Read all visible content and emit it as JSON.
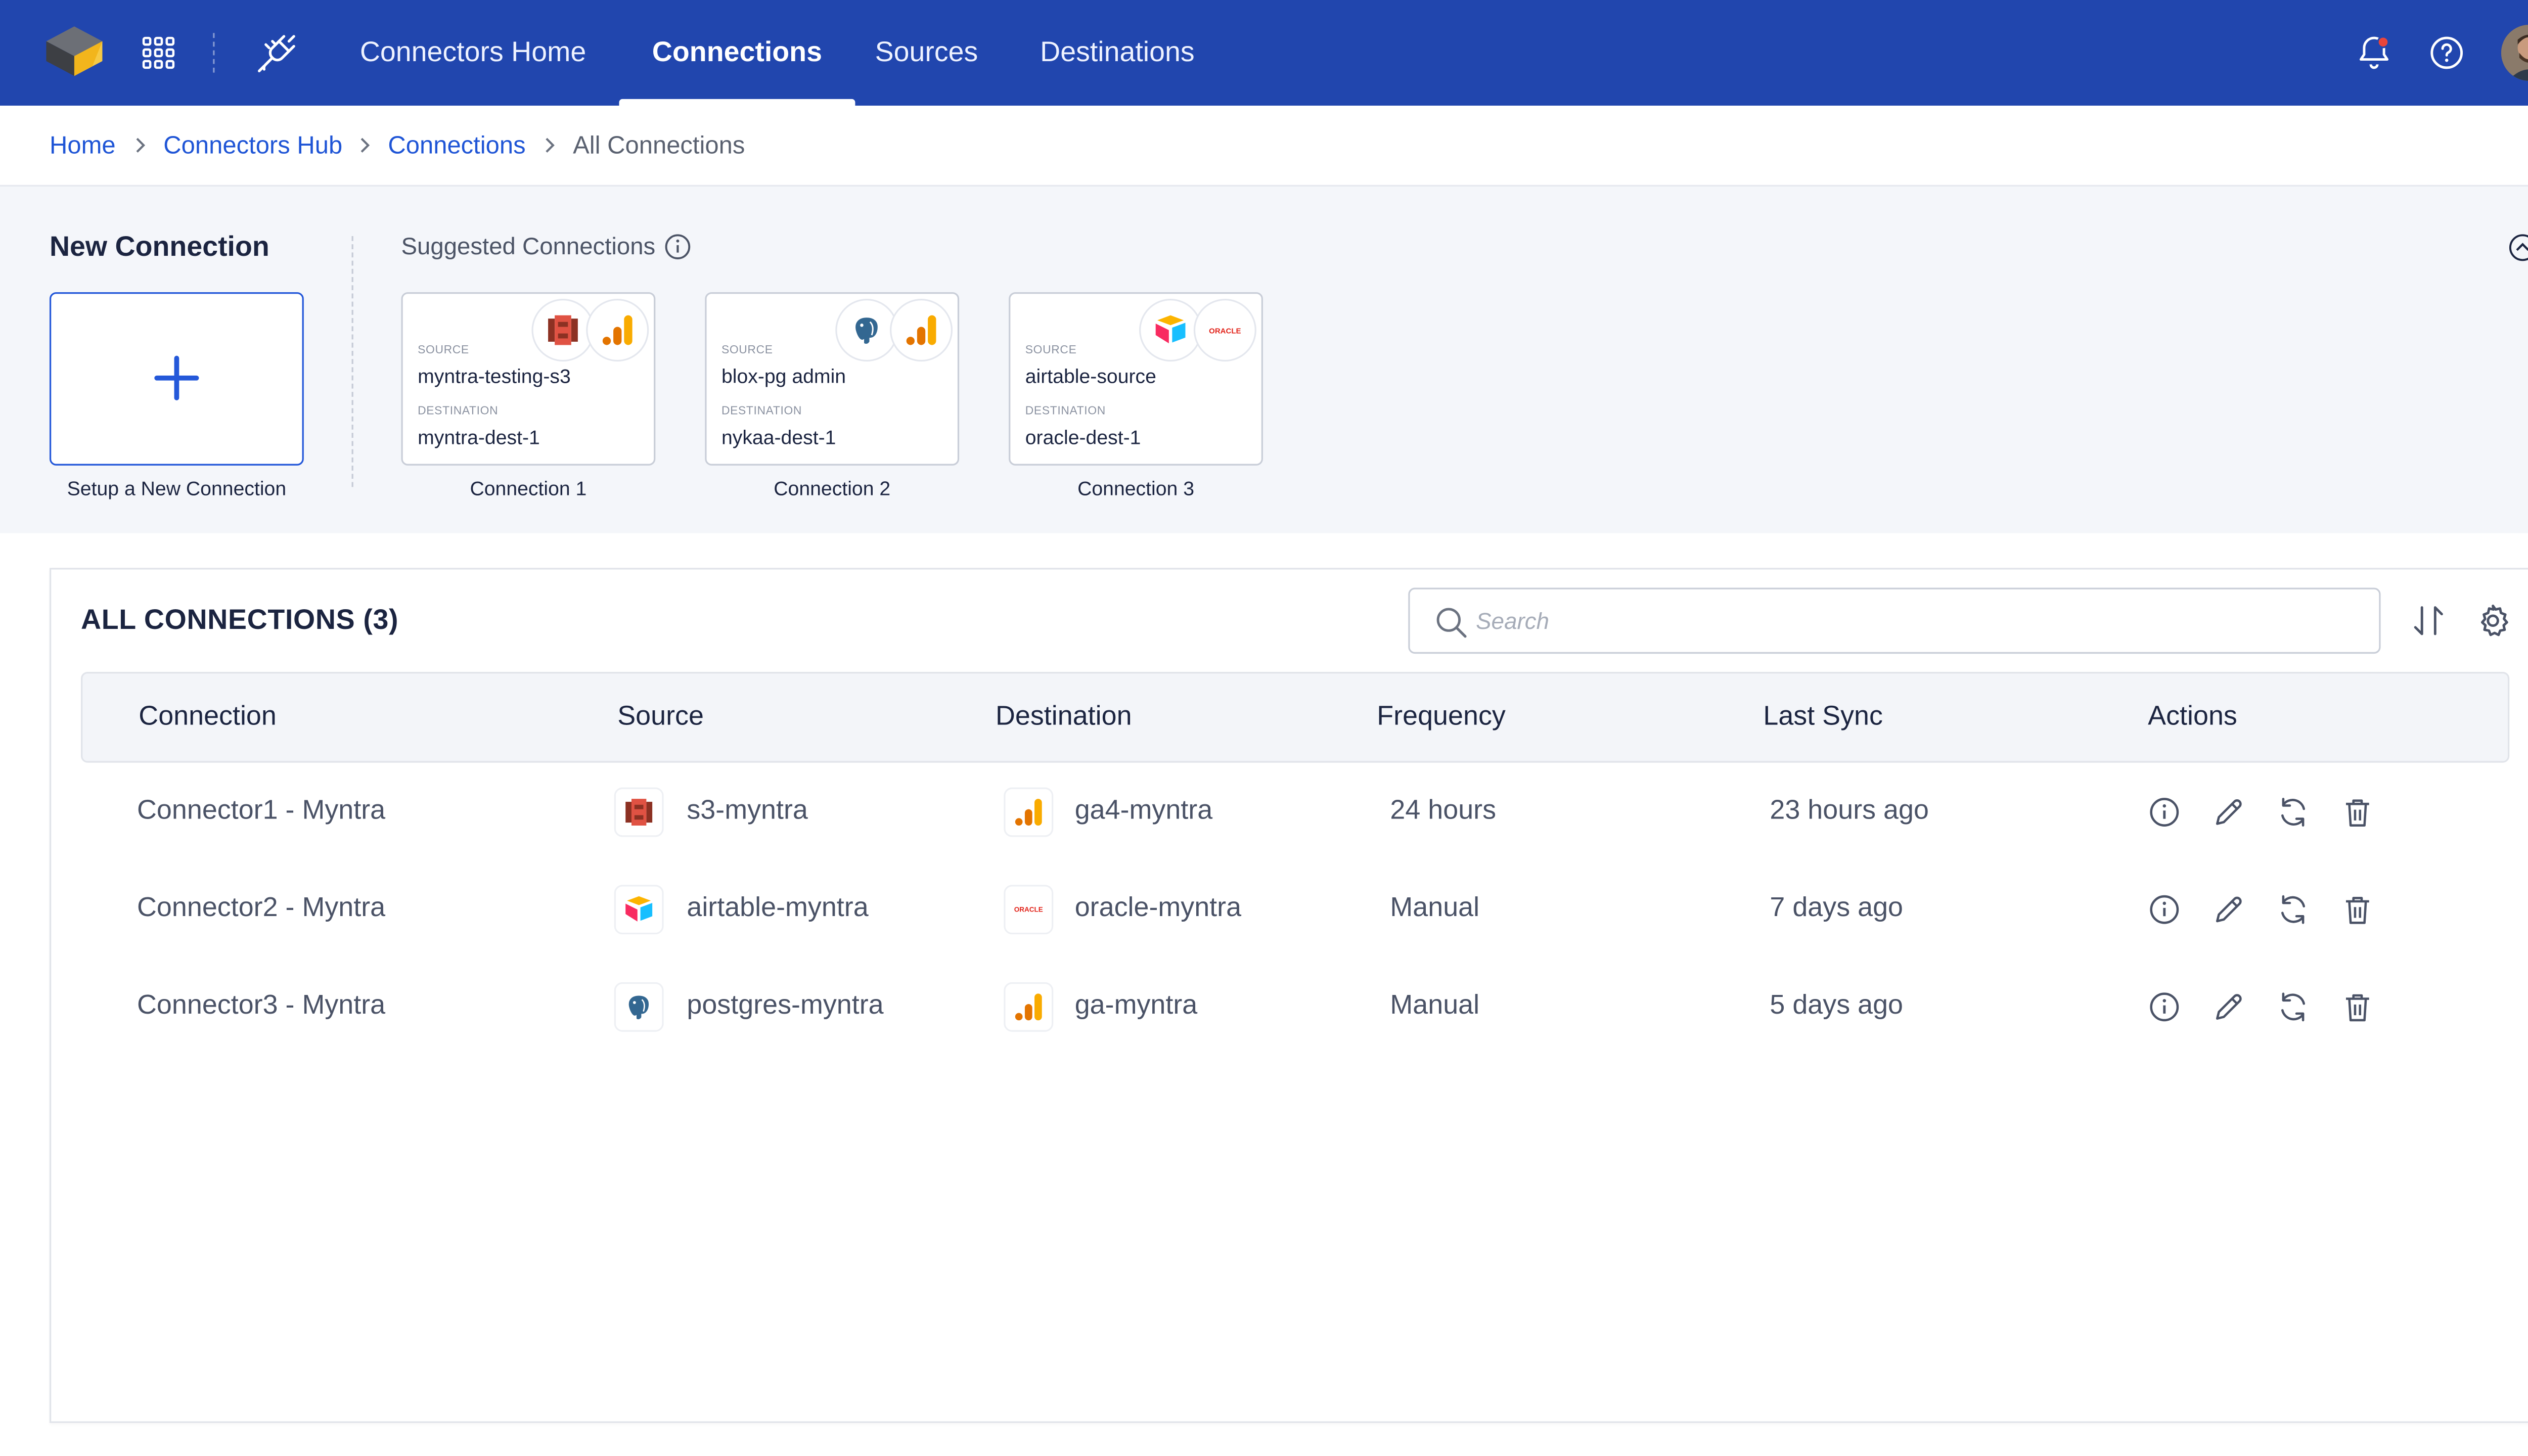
{
  "nav": {
    "tabs": [
      {
        "label": "Connectors Home",
        "active": false
      },
      {
        "label": "Connections",
        "active": true
      },
      {
        "label": "Sources",
        "active": false
      },
      {
        "label": "Destinations",
        "active": false
      }
    ],
    "brand_color": "#2146ae",
    "icons": [
      "logo-icon",
      "apps-grid-icon",
      "plug-icon",
      "bell-icon",
      "help-icon",
      "avatar"
    ]
  },
  "breadcrumb": [
    "Home",
    "Connectors Hub",
    "Connections",
    "All Connections"
  ],
  "new_connection": {
    "title": "New Connection",
    "add_label": "Setup a New Connection"
  },
  "suggested": {
    "title": "Suggested Connections",
    "source_label": "SOURCE",
    "destination_label": "DESTINATION",
    "cards": [
      {
        "caption": "Connection 1",
        "source": "myntra-testing-s3",
        "destination": "myntra-dest-1",
        "source_icon": "aws-s3-icon",
        "dest_icon": "google-analytics-icon"
      },
      {
        "caption": "Connection 2",
        "source": "blox-pg admin",
        "destination": "nykaa-dest-1",
        "source_icon": "postgres-icon",
        "dest_icon": "google-analytics-icon"
      },
      {
        "caption": "Connection 3",
        "source": "airtable-source",
        "destination": "oracle-dest-1",
        "source_icon": "airtable-icon",
        "dest_icon": "oracle-icon"
      }
    ],
    "oracle_text": "ORACLE"
  },
  "all_connections": {
    "title": "ALL CONNECTIONS (3)",
    "search_placeholder": "Search",
    "columns": [
      "Connection",
      "Source",
      "Destination",
      "Frequency",
      "Last Sync",
      "Actions"
    ],
    "rows": [
      {
        "connection": "Connector1 - Myntra",
        "source": "s3-myntra",
        "source_icon": "aws-s3-icon",
        "destination": "ga4-myntra",
        "dest_icon": "google-analytics-icon",
        "frequency": "24 hours",
        "last_sync": "23 hours ago"
      },
      {
        "connection": "Connector2 - Myntra",
        "source": "airtable-myntra",
        "source_icon": "airtable-icon",
        "destination": "oracle-myntra",
        "dest_icon": "oracle-icon",
        "frequency": "Manual",
        "last_sync": "7 days ago"
      },
      {
        "connection": "Connector3 - Myntra",
        "source": "postgres-myntra",
        "source_icon": "postgres-icon",
        "destination": "ga-myntra",
        "dest_icon": "google-analytics-icon",
        "frequency": "Manual",
        "last_sync": "5 days ago"
      }
    ],
    "action_icons": [
      "info-icon",
      "edit-icon",
      "sync-icon",
      "delete-icon"
    ]
  },
  "colors": {
    "accent": "#2458d9",
    "link": "#1f55d6",
    "notification_dot": "#e8453c"
  }
}
